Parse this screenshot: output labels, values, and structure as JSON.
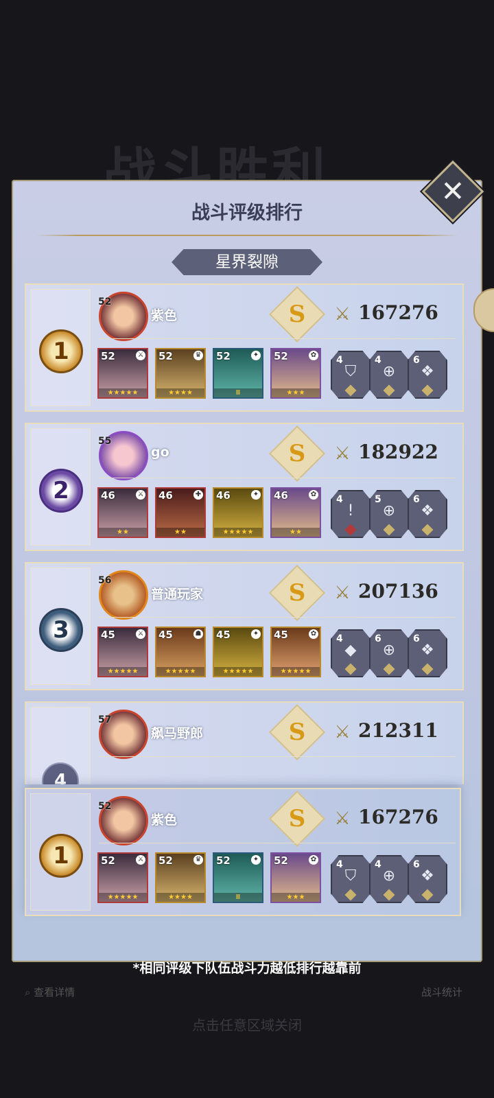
{
  "background": {
    "title_watermark": "战斗胜利"
  },
  "panel": {
    "title": "战斗评级排行",
    "subtab": "星界裂隙",
    "close_icon": "close-icon"
  },
  "rows": [
    {
      "rank": "1",
      "avatar_level": "52",
      "player_name": "紫色",
      "grade": "S",
      "power": "167276",
      "heroes": [
        {
          "level": "52"
        },
        {
          "level": "52"
        },
        {
          "level": "52"
        },
        {
          "level": "52"
        }
      ],
      "runes": [
        {
          "count": "4"
        },
        {
          "count": "4"
        },
        {
          "count": "6"
        }
      ]
    },
    {
      "rank": "2",
      "avatar_level": "55",
      "player_name": "go",
      "grade": "S",
      "power": "182922",
      "heroes": [
        {
          "level": "46"
        },
        {
          "level": "46"
        },
        {
          "level": "46"
        },
        {
          "level": "46"
        }
      ],
      "runes": [
        {
          "count": "4"
        },
        {
          "count": "5"
        },
        {
          "count": "6"
        }
      ]
    },
    {
      "rank": "3",
      "avatar_level": "56",
      "player_name": "普通玩家",
      "grade": "S",
      "power": "207136",
      "heroes": [
        {
          "level": "45"
        },
        {
          "level": "45"
        },
        {
          "level": "45"
        },
        {
          "level": "45"
        }
      ],
      "runes": [
        {
          "count": "4"
        },
        {
          "count": "6"
        },
        {
          "count": "6"
        }
      ]
    },
    {
      "rank": "4",
      "avatar_level": "57",
      "player_name": "飙马野郎",
      "grade": "S",
      "power": "212311",
      "heroes": [],
      "runes": []
    }
  ],
  "my_row": {
    "rank": "1",
    "avatar_level": "52",
    "player_name": "紫色",
    "grade": "S",
    "power": "167276",
    "heroes": [
      {
        "level": "52"
      },
      {
        "level": "52"
      },
      {
        "level": "52"
      },
      {
        "level": "52"
      }
    ],
    "runes": [
      {
        "count": "4"
      },
      {
        "count": "4"
      },
      {
        "count": "6"
      }
    ]
  },
  "footer": {
    "note": "*相同评级下队伍战斗力越低排行越靠前",
    "view_details": "查看详情",
    "battle_stats": "战斗统计",
    "tap_close": "点击任意区域关闭"
  }
}
